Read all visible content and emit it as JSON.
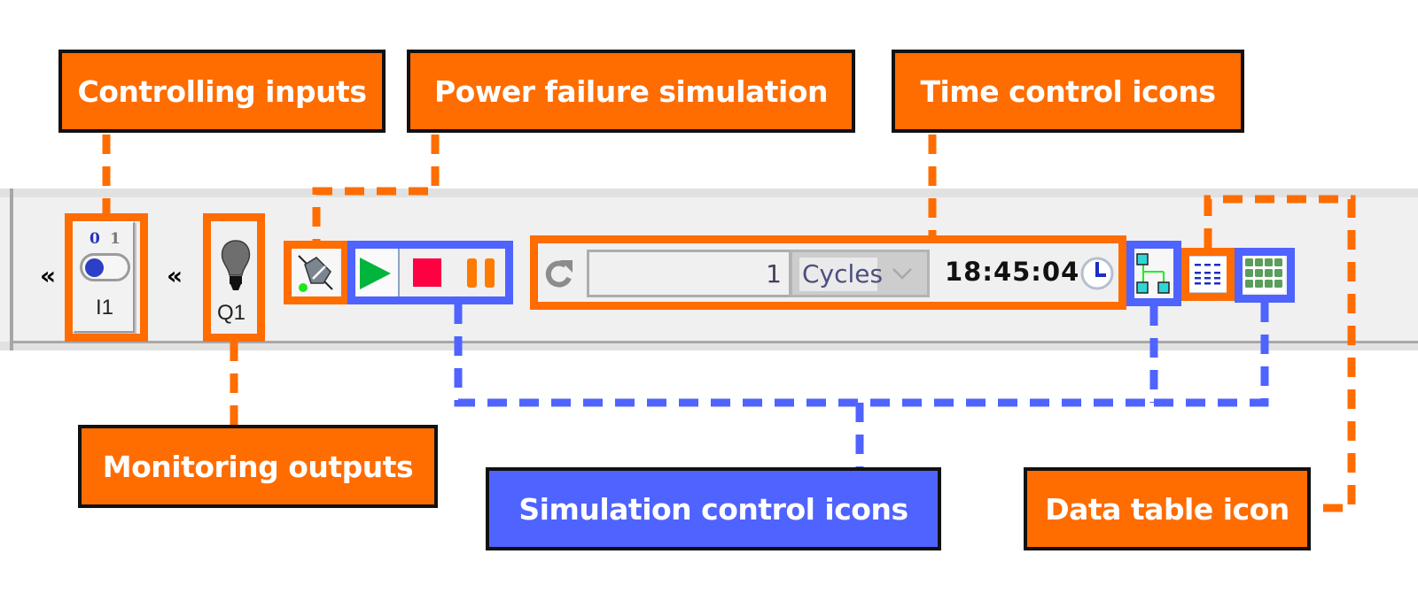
{
  "callouts": {
    "controlling_inputs": "Controlling inputs",
    "power_failure": "Power failure simulation",
    "time_control": "Time control icons",
    "monitoring_outputs": "Monitoring outputs",
    "simulation_control": "Simulation control icons",
    "data_table": "Data table icon"
  },
  "toolbar": {
    "collapse_glyph": "«",
    "input": {
      "bit_off": "0",
      "bit_on": "1",
      "label": "I1",
      "state": 0,
      "icon": "toggle-switch-icon"
    },
    "output": {
      "label": "Q1",
      "state": "off",
      "icon": "light-bulb-icon"
    },
    "power_failure_icon": "power-plug-disconnect-icon",
    "simulation": {
      "run_icon": "play-icon",
      "stop_icon": "stop-icon",
      "pause_icon": "pause-icon",
      "network_icon": "network-tree-icon",
      "grid_icon": "grid-table-icon"
    },
    "time": {
      "reset_icon": "refresh-icon",
      "cycle_count": "1",
      "unit": "Cycles",
      "clock": "18:45:04",
      "clock_icon": "clock-icon"
    },
    "data_table_icon": "data-table-icon"
  },
  "colors": {
    "orange": "#ff6c00",
    "blue": "#4f63ff",
    "play": "#00b43c",
    "stop": "#ff0040",
    "pause": "#ff7a00"
  }
}
